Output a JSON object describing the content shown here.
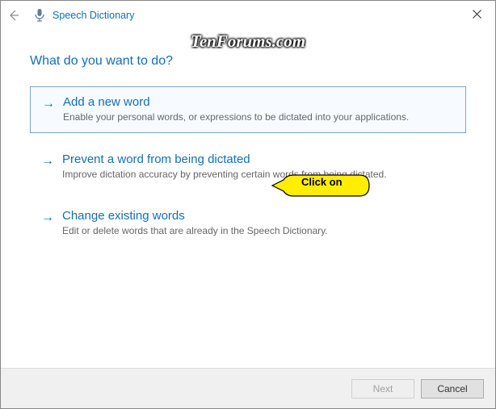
{
  "titlebar": {
    "title": "Speech Dictionary"
  },
  "watermark": "TenForums.com",
  "heading": "What do you want to do?",
  "options": [
    {
      "title": "Add a new word",
      "desc": "Enable your personal words, or expressions to be dictated into your applications."
    },
    {
      "title": "Prevent a word from being dictated",
      "desc": "Improve dictation accuracy by preventing certain words from being dictated."
    },
    {
      "title": "Change existing words",
      "desc": "Edit or delete words that are already in the Speech Dictionary."
    }
  ],
  "callout": "Click on",
  "footer": {
    "next": "Next",
    "cancel": "Cancel"
  }
}
